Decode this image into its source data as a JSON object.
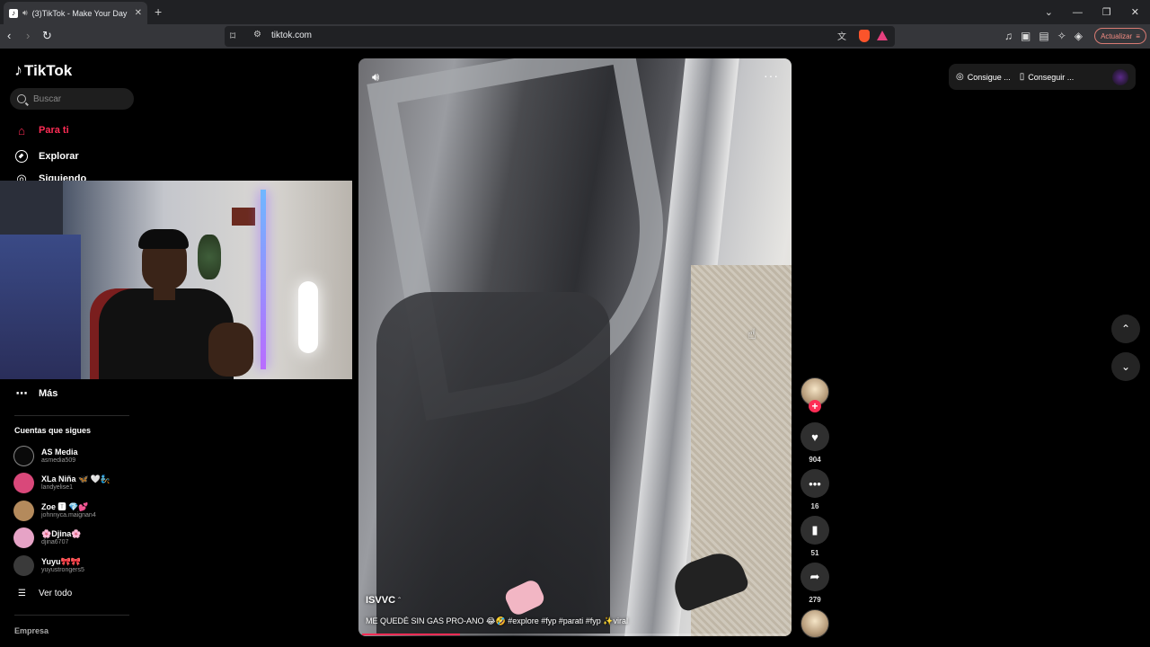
{
  "browser": {
    "tab_title": "(3)TikTok - Make Your Day",
    "url": "tiktok.com",
    "update_label": "Actualizar",
    "window_controls": [
      "⌄",
      "—",
      "❐",
      "✕"
    ]
  },
  "sidebar": {
    "logo": "TikTok",
    "search_placeholder": "Buscar",
    "nav": {
      "home": "Para ti",
      "explore": "Explorar",
      "following": "Siguiendo",
      "more": "Más"
    },
    "following_title": "Cuentas que sigues",
    "accounts": [
      {
        "name": "AS Media",
        "username": "asmedia509",
        "color": "#0a0a0a"
      },
      {
        "name": "XLa Niña 🦋 🤍🧞",
        "username": "landyelise1",
        "color": "#d9487a"
      },
      {
        "name": "Zoe 🆃 💎💕",
        "username": "johnnyca.maignan4",
        "color": "#b48a5c"
      },
      {
        "name": "🌸Djina🌸",
        "username": "djina6707",
        "color": "#e6a3c6"
      },
      {
        "name": "Yuyu🎀🎀",
        "username": "yuyustrongers5",
        "color": "#3a3a3a"
      }
    ],
    "see_all": "Ver todo",
    "company": "Empresa"
  },
  "video": {
    "author": "ISVVC",
    "caption": "ME QUEDÉ SIN GAS PRO-ANO 😂🤣 #explore #fyp #parati #fyp ✨viral",
    "progress": 0.23,
    "likes": "904",
    "comments": "16",
    "saves": "51",
    "shares": "279"
  },
  "topbar": {
    "coins": "Consigue ...",
    "app": "Conseguir ..."
  },
  "colors": {
    "accent": "#fe2c55",
    "background": "#000000"
  }
}
